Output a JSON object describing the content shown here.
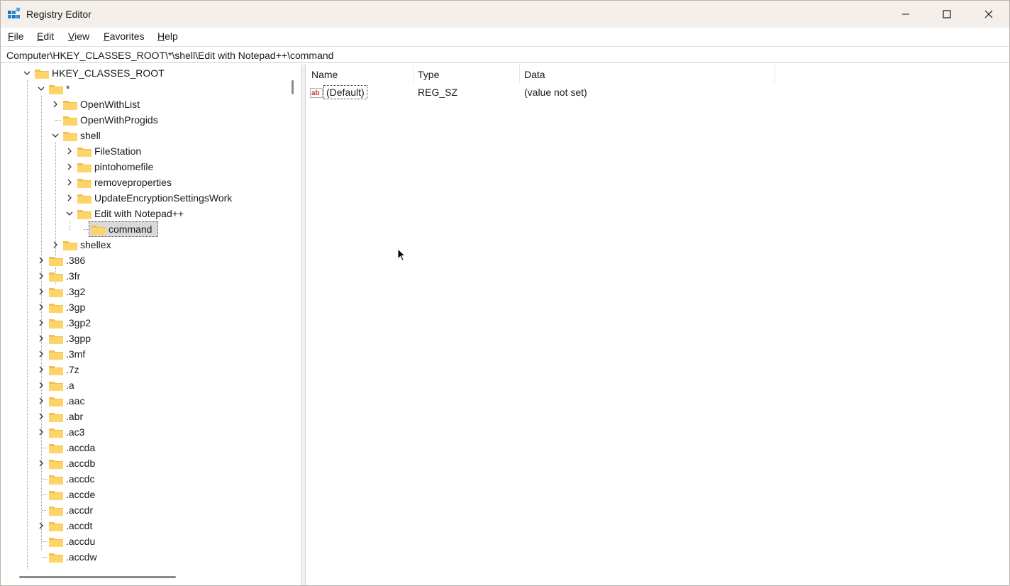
{
  "window": {
    "title": "Registry Editor",
    "accent": "#0078d4"
  },
  "menu": [
    "File",
    "Edit",
    "View",
    "Favorites",
    "Help"
  ],
  "address_bar": {
    "path": "Computer\\HKEY_CLASSES_ROOT\\*\\shell\\Edit with Notepad++\\command"
  },
  "tree": {
    "root": "HKEY_CLASSES_ROOT",
    "star": "*",
    "openwithlist": "OpenWithList",
    "openwithprogids": "OpenWithProgids",
    "shell": "shell",
    "filestation": "FileStation",
    "pintohomefile": "pintohomefile",
    "removeproperties": "removeproperties",
    "updateencryption": "UpdateEncryptionSettingsWork",
    "editnotepad": "Edit with Notepad++",
    "command": "command",
    "shellex": "shellex",
    "ext": [
      ".386",
      ".3fr",
      ".3g2",
      ".3gp",
      ".3gp2",
      ".3gpp",
      ".3mf",
      ".7z",
      ".a",
      ".aac",
      ".abr",
      ".ac3",
      ".accda",
      ".accdb",
      ".accdc",
      ".accde",
      ".accdr",
      ".accdt",
      ".accdu",
      ".accdw"
    ]
  },
  "columns": {
    "name": "Name",
    "type": "Type",
    "data": "Data"
  },
  "values": [
    {
      "name": "(Default)",
      "type": "REG_SZ",
      "data": "(value not set)",
      "icon": "string-value-icon"
    }
  ]
}
